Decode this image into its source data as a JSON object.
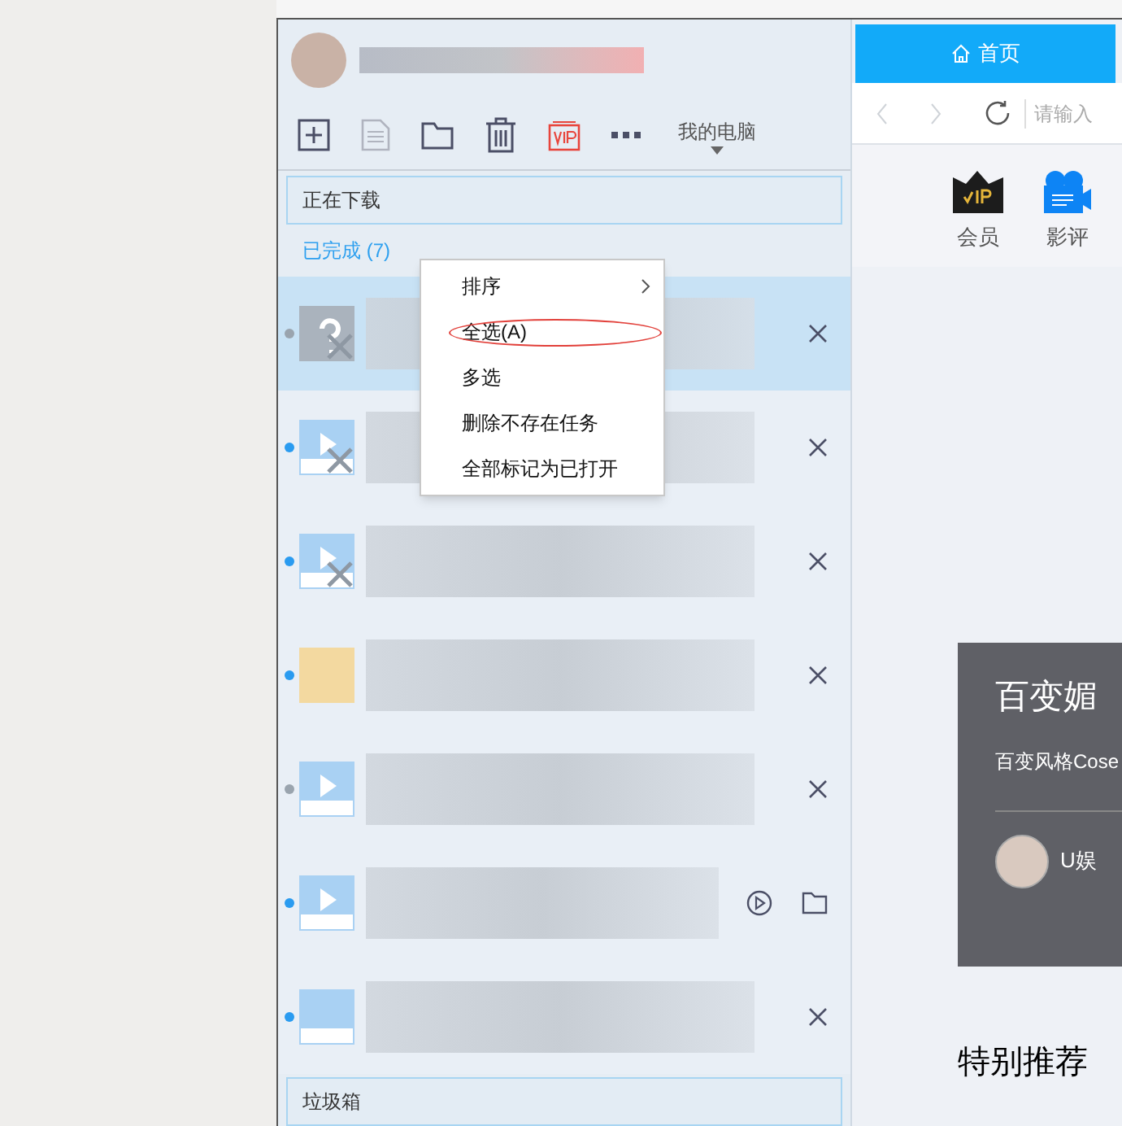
{
  "toolbar": {
    "location": "我的电脑"
  },
  "sections": {
    "downloading": "正在下载",
    "completed": "已完成 (7)",
    "trash": "垃圾箱"
  },
  "tasks": [
    {
      "kind": "unknown",
      "missing": true,
      "new": false,
      "selected": true,
      "hovered": false
    },
    {
      "kind": "video",
      "missing": true,
      "new": true,
      "selected": false,
      "hovered": false
    },
    {
      "kind": "video",
      "missing": true,
      "new": true,
      "selected": false,
      "hovered": false
    },
    {
      "kind": "folder",
      "missing": false,
      "new": true,
      "selected": false,
      "hovered": false
    },
    {
      "kind": "video",
      "missing": false,
      "new": false,
      "selected": false,
      "hovered": false
    },
    {
      "kind": "video",
      "missing": false,
      "new": true,
      "selected": false,
      "hovered": true
    },
    {
      "kind": "rm",
      "missing": false,
      "new": true,
      "selected": false,
      "hovered": false
    }
  ],
  "context_menu": [
    {
      "label": "排序",
      "submenu": true,
      "circled": false
    },
    {
      "label": "全选(A)",
      "submenu": false,
      "circled": true
    },
    {
      "label": "多选",
      "submenu": false,
      "circled": false
    },
    {
      "label": "删除不存在任务",
      "submenu": false,
      "circled": false
    },
    {
      "label": "全部标记为已打开",
      "submenu": false,
      "circled": false
    }
  ],
  "browser": {
    "tab": "首页",
    "address_placeholder": "请输入",
    "shortcuts": [
      {
        "kind": "vip",
        "label": "会员"
      },
      {
        "kind": "review",
        "label": "影评"
      }
    ],
    "card": {
      "title": "百变媚",
      "subtitle": "百变风格Cose",
      "author": "U娱"
    },
    "heading": "特别推荐"
  }
}
